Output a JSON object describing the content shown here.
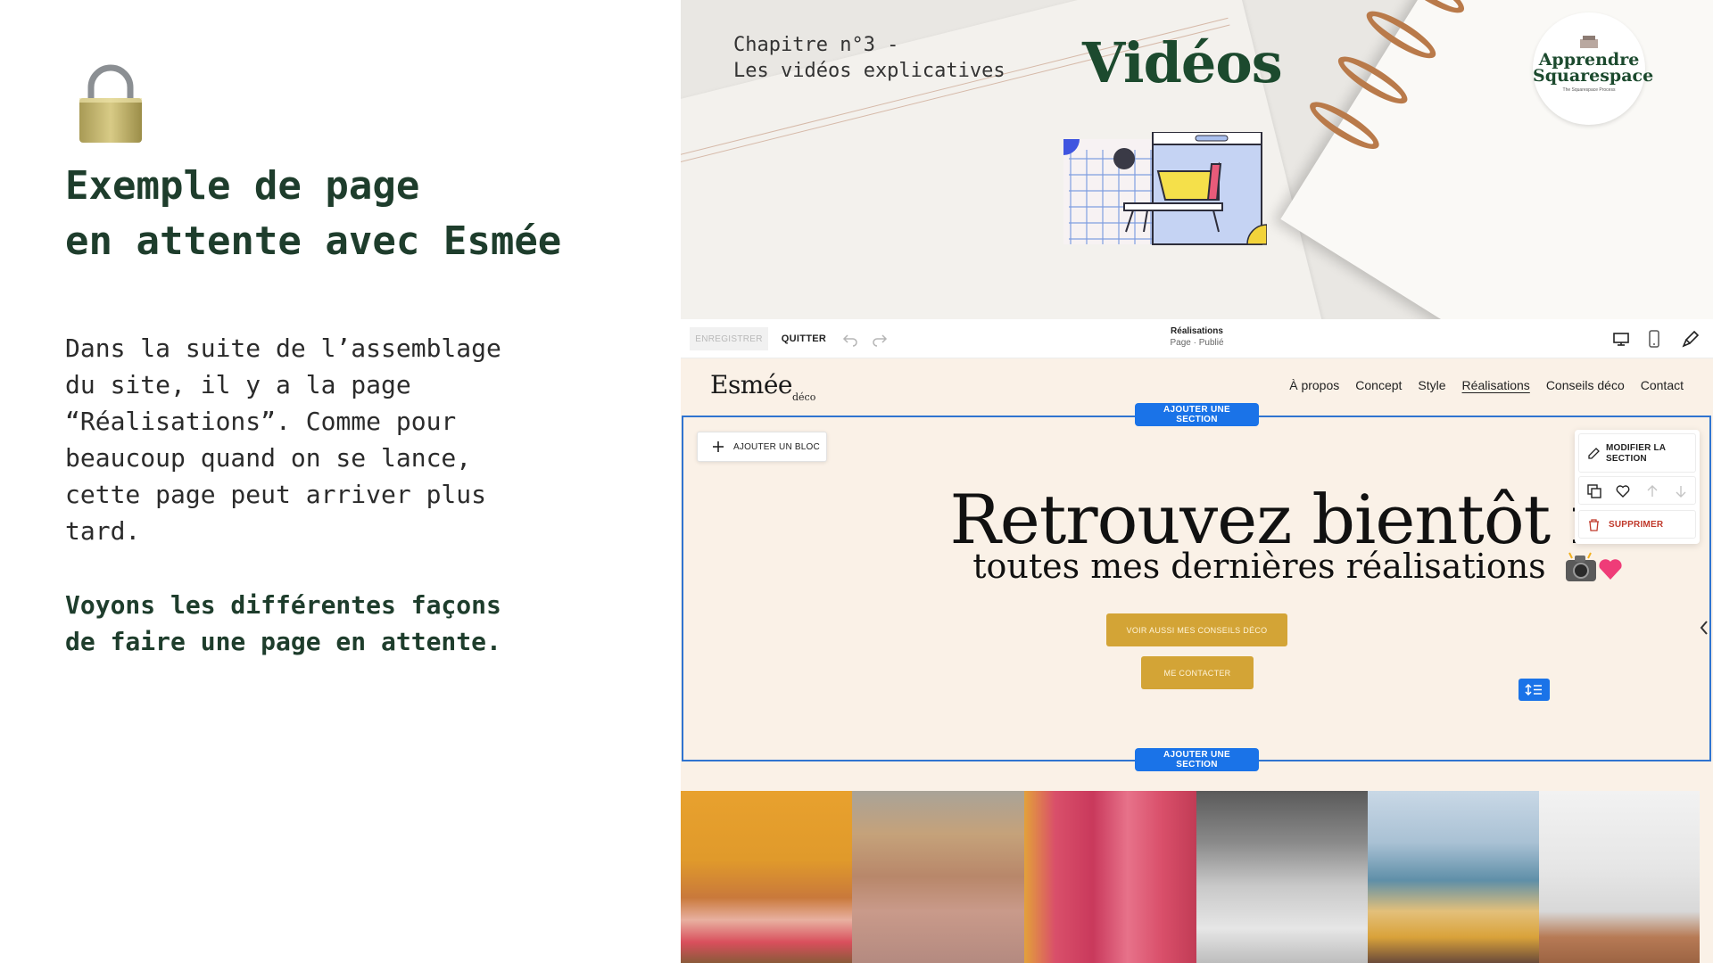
{
  "slide": {
    "title_lines": [
      "Exemple de page",
      "en attente avec Esmée"
    ],
    "paragraph_lines": [
      "Dans la suite de l’assemblage",
      "du site, il y a la page",
      "“Réalisations”. Comme pour",
      "beaucoup quand on se lance,",
      "cette page peut arriver plus",
      "tard."
    ],
    "bold_lines": [
      "Voyons les différentes façons",
      "de faire une page en attente."
    ],
    "icon": "lock-icon"
  },
  "banner": {
    "chapter_lines": [
      "Chapitre n°3 -",
      "Les vidéos explicatives"
    ],
    "title": "Vidéos",
    "logo": {
      "line1": "Apprendre",
      "line2": "Squarespace",
      "line3": "The Squarespace Process"
    }
  },
  "editor": {
    "toolbar": {
      "save_label": "ENREGISTRER",
      "quit_label": "QUITTER",
      "page_name": "Réalisations",
      "page_status": "Page · Publié"
    },
    "site": {
      "logo": "Esmée",
      "logo_sub": "déco",
      "nav": [
        "À propos",
        "Concept",
        "Style",
        "Réalisations",
        "Conseils déco",
        "Contact"
      ],
      "active_nav": "Réalisations",
      "add_section_label": "AJOUTER UNE SECTION",
      "add_block_label": "AJOUTER UN BLOC",
      "hero_title": "Retrouvez bientôt ici",
      "hero_subtitle": "toutes mes dernières réalisations",
      "cta_primary": "VOIR AUSSI MES CONSEILS DÉCO",
      "cta_secondary": "ME CONTACTER",
      "section_menu": {
        "edit_label": "MODIFIER LA SECTION",
        "delete_label": "SUPPRIMER"
      }
    }
  },
  "colors": {
    "title_green": "#1e3d2c",
    "editor_blue": "#1a73e8",
    "cta_gold": "#d3a436",
    "site_bg": "#faf1e7",
    "delete_red": "#c0392b"
  }
}
